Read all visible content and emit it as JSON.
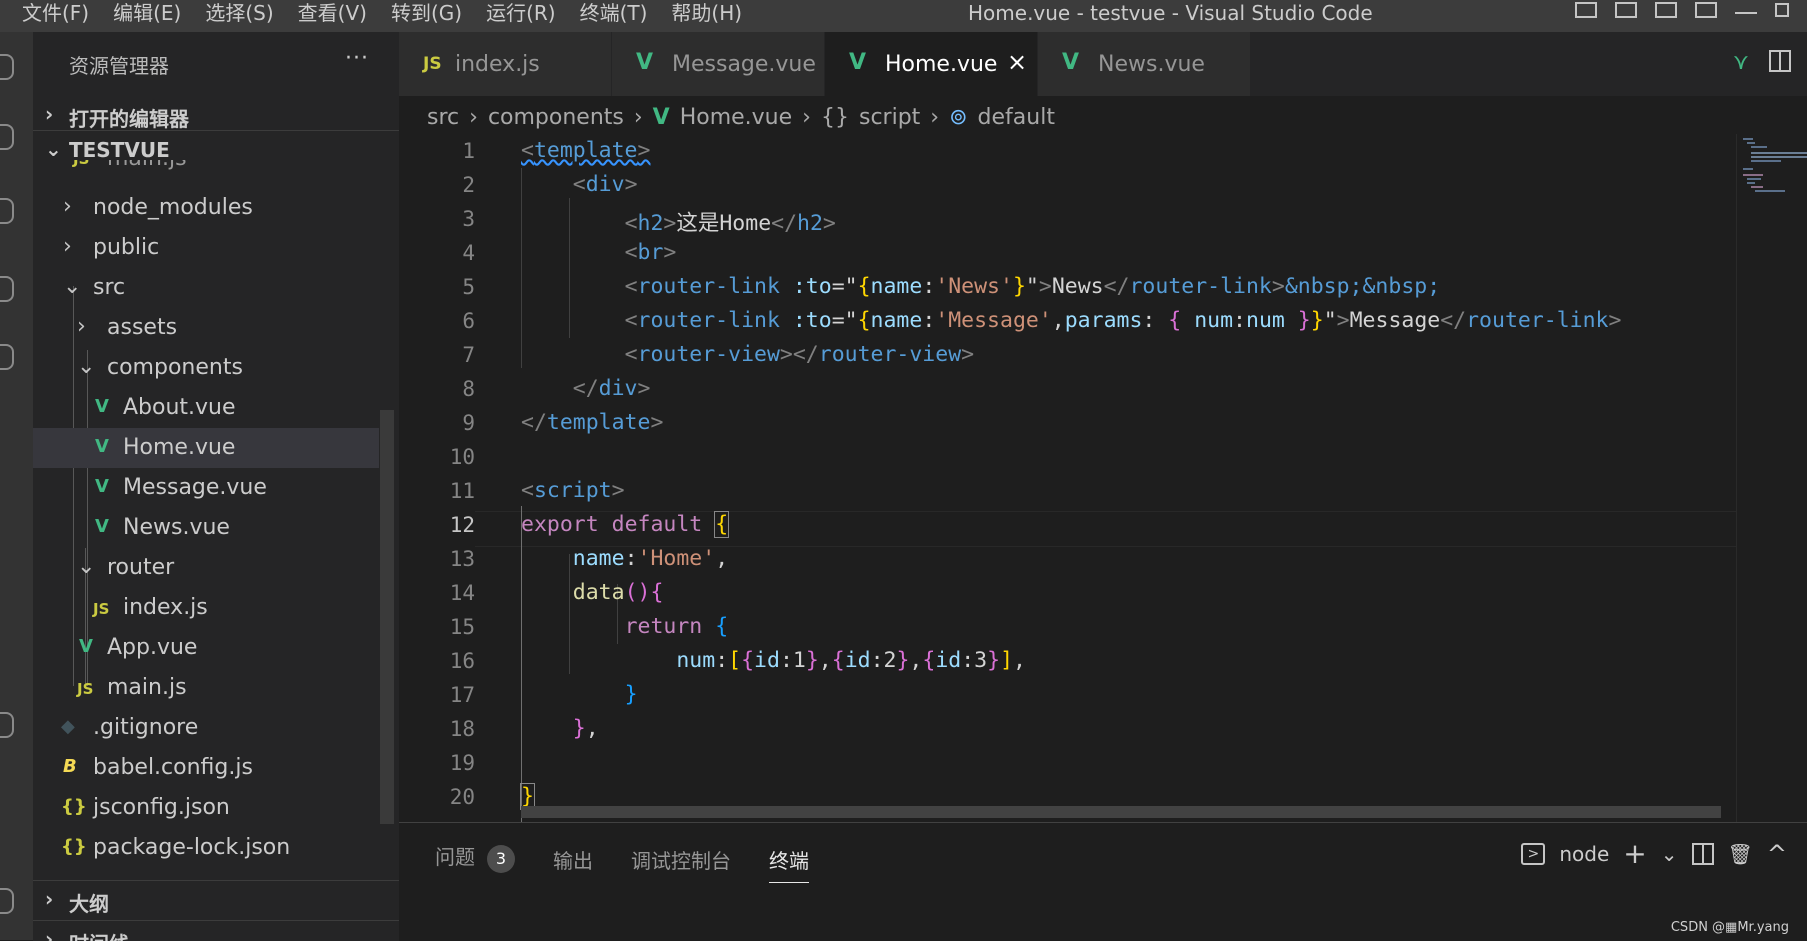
{
  "menu": [
    "文件(F)",
    "编辑(E)",
    "选择(S)",
    "查看(V)",
    "转到(G)",
    "运行(R)",
    "终端(T)",
    "帮助(H)"
  ],
  "window_title": "Home.vue - testvue - Visual Studio Code",
  "sidebar": {
    "title": "资源管理器",
    "more": "···",
    "open_editors": "打开的编辑器",
    "project": "TESTVUE",
    "partial_item": "main.js",
    "items": [
      {
        "name": "node_modules",
        "type": "folder"
      },
      {
        "name": "public",
        "type": "folder"
      },
      {
        "name": "src",
        "type": "folder-open"
      },
      {
        "name": "assets",
        "type": "folder"
      },
      {
        "name": "components",
        "type": "folder-open"
      },
      {
        "name": "About.vue",
        "type": "vue"
      },
      {
        "name": "Home.vue",
        "type": "vue",
        "selected": true
      },
      {
        "name": "Message.vue",
        "type": "vue"
      },
      {
        "name": "News.vue",
        "type": "vue"
      },
      {
        "name": "router",
        "type": "folder-open"
      },
      {
        "name": "index.js",
        "type": "js"
      },
      {
        "name": "App.vue",
        "type": "vue"
      },
      {
        "name": "main.js",
        "type": "js"
      },
      {
        "name": ".gitignore",
        "type": "git"
      },
      {
        "name": "babel.config.js",
        "type": "babel"
      },
      {
        "name": "jsconfig.json",
        "type": "json"
      },
      {
        "name": "package-lock.json",
        "type": "json"
      }
    ],
    "outline": "大纲",
    "timeline": "时间线"
  },
  "tabs": [
    {
      "icon": "JS",
      "label": "index.js"
    },
    {
      "icon": "V",
      "label": "Message.vue"
    },
    {
      "icon": "V",
      "label": "Home.vue",
      "active": true
    },
    {
      "icon": "V",
      "label": "News.vue"
    }
  ],
  "close_glyph": "×",
  "breadcrumb": {
    "src": "src",
    "components": "components",
    "file": "Home.vue",
    "script": "script",
    "default": "default",
    "script_glyph": "{}",
    "default_glyph": "⊚"
  },
  "line_numbers": [
    "1",
    "2",
    "3",
    "4",
    "5",
    "6",
    "7",
    "8",
    "9",
    "10",
    "11",
    "12",
    "13",
    "14",
    "15",
    "16",
    "17",
    "18",
    "19",
    "20"
  ],
  "current_line": "12",
  "panel": {
    "problems": "问题",
    "problems_count": "3",
    "output": "输出",
    "debug_console": "调试控制台",
    "terminal": "终端",
    "shell": "node",
    "plus": "+",
    "chevron": "⌄",
    "trash": "🗑",
    "maximize": "^"
  },
  "watermark": "CSDN @▦Mr.yang",
  "colors": {
    "accent": "#41b883",
    "tag": "#569cd6",
    "string": "#ce9178",
    "keyword": "#c586c0"
  }
}
